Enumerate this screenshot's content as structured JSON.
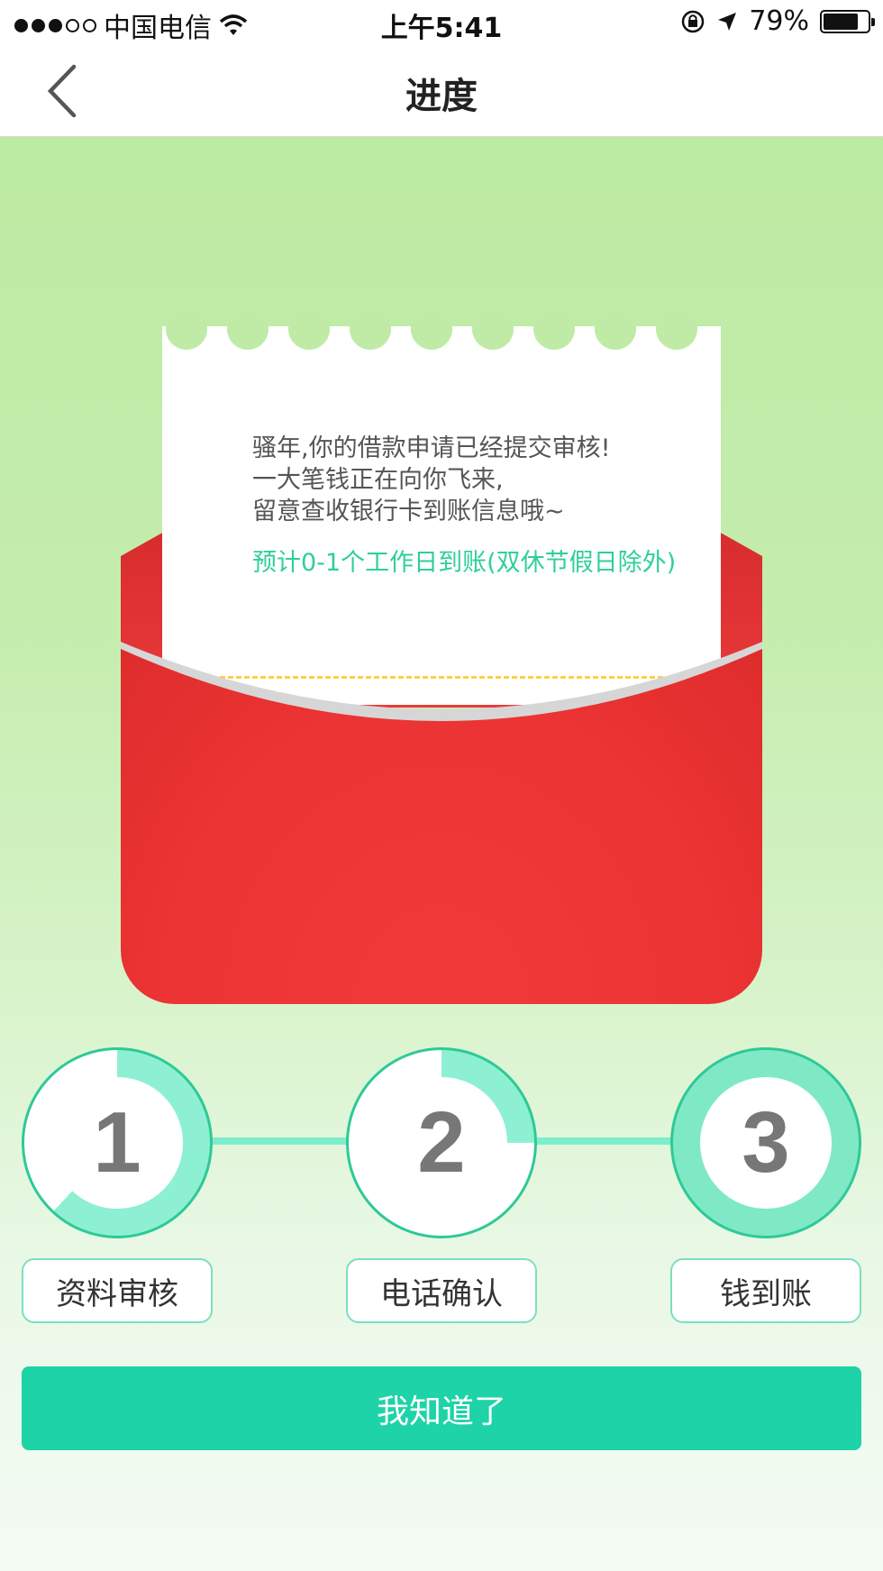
{
  "status_bar": {
    "carrier": "中国电信",
    "time": "上午5:41",
    "battery_percent": "79%",
    "battery_level": 0.79,
    "signal_bars_filled": 3,
    "signal_bars_total": 5
  },
  "nav": {
    "title": "进度"
  },
  "letter": {
    "line1": "骚年,你的借款申请已经提交审核!",
    "line2": "一大笔钱正在向你飞来,",
    "line3": "留意查收银行卡到账信息哦~",
    "note": "预计0-1个工作日到账(双休节假日除外)"
  },
  "steps": [
    {
      "number": "1",
      "label": "资料审核",
      "progress": 0.62
    },
    {
      "number": "2",
      "label": "电话确认",
      "progress": 0.25
    },
    {
      "number": "3",
      "label": "钱到账",
      "progress": 1.0
    }
  ],
  "confirm_button": "我知道了",
  "colors": {
    "accent": "#1dd3a7",
    "envelope": "#e53935",
    "note_text": "#2fcf98"
  }
}
